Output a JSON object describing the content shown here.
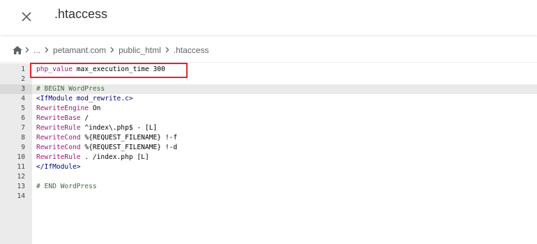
{
  "header": {
    "title": ".htaccess",
    "close_icon": "close-icon"
  },
  "breadcrumb": {
    "home_icon": "home-icon",
    "items": [
      "...",
      "petamant.com",
      "public_html",
      ".htaccess"
    ]
  },
  "editor": {
    "active_line": 3,
    "highlighted_line": 1,
    "lines": [
      {
        "n": "1",
        "parts": [
          {
            "t": "php_value",
            "c": "kw"
          },
          {
            "t": " max_execution_time 300",
            "c": ""
          }
        ]
      },
      {
        "n": "2",
        "parts": []
      },
      {
        "n": "3",
        "parts": [
          {
            "t": "# BEGIN WordPress",
            "c": "cm"
          }
        ]
      },
      {
        "n": "4",
        "parts": [
          {
            "t": "<IfModule mod_rewrite.c>",
            "c": "tag"
          }
        ]
      },
      {
        "n": "5",
        "parts": [
          {
            "t": "RewriteEngine",
            "c": "kw"
          },
          {
            "t": " On",
            "c": ""
          }
        ]
      },
      {
        "n": "6",
        "parts": [
          {
            "t": "RewriteBase",
            "c": "kw"
          },
          {
            "t": " /",
            "c": ""
          }
        ]
      },
      {
        "n": "7",
        "parts": [
          {
            "t": "RewriteRule",
            "c": "kw"
          },
          {
            "t": " ^index\\.php$ - [L]",
            "c": ""
          }
        ]
      },
      {
        "n": "8",
        "parts": [
          {
            "t": "RewriteCond",
            "c": "kw"
          },
          {
            "t": " %{REQUEST_FILENAME} !-f",
            "c": ""
          }
        ]
      },
      {
        "n": "9",
        "parts": [
          {
            "t": "RewriteCond",
            "c": "kw"
          },
          {
            "t": " %{REQUEST_FILENAME} !-d",
            "c": ""
          }
        ]
      },
      {
        "n": "10",
        "parts": [
          {
            "t": "RewriteRule",
            "c": "kw"
          },
          {
            "t": " . /index.php [L]",
            "c": ""
          }
        ]
      },
      {
        "n": "11",
        "parts": [
          {
            "t": "</IfModule>",
            "c": "tag"
          }
        ]
      },
      {
        "n": "12",
        "parts": []
      },
      {
        "n": "13",
        "parts": [
          {
            "t": "# END WordPress",
            "c": "cm"
          }
        ]
      },
      {
        "n": "14",
        "parts": []
      }
    ]
  },
  "colors": {
    "highlight_border": "#e0262b",
    "keyword": "#a0157a",
    "comment": "#3c6b3c",
    "tag": "#000088"
  }
}
